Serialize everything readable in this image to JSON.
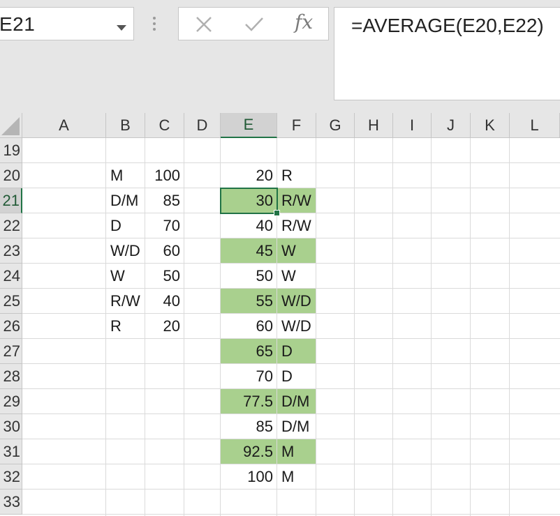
{
  "name_box": {
    "value": "E21"
  },
  "formula_bar": {
    "fx_label": "fx",
    "formula": "=AVERAGE(E20,E22)"
  },
  "colors": {
    "accent": "#217346",
    "fill_green": "#a9d08e"
  },
  "grid": {
    "columns": [
      "A",
      "B",
      "C",
      "D",
      "E",
      "F",
      "G",
      "H",
      "I",
      "J",
      "K",
      "L"
    ],
    "selected_column": "E",
    "rows": [
      "19",
      "20",
      "21",
      "22",
      "23",
      "24",
      "25",
      "26",
      "27",
      "28",
      "29",
      "30",
      "31",
      "32",
      "33"
    ],
    "selected_row": "21",
    "lookup_table": [
      {
        "row": "20",
        "B": "M",
        "C": "100"
      },
      {
        "row": "21",
        "B": "D/M",
        "C": "85"
      },
      {
        "row": "22",
        "B": "D",
        "C": "70"
      },
      {
        "row": "23",
        "B": "W/D",
        "C": "60"
      },
      {
        "row": "24",
        "B": "W",
        "C": "50"
      },
      {
        "row": "25",
        "B": "R/W",
        "C": "40"
      },
      {
        "row": "26",
        "B": "R",
        "C": "20"
      }
    ],
    "value_table": [
      {
        "row": "20",
        "E": "20",
        "F": "R",
        "shaded": false
      },
      {
        "row": "21",
        "E": "30",
        "F": "R/W",
        "shaded": true
      },
      {
        "row": "22",
        "E": "40",
        "F": "R/W",
        "shaded": false
      },
      {
        "row": "23",
        "E": "45",
        "F": "W",
        "shaded": true
      },
      {
        "row": "24",
        "E": "50",
        "F": "W",
        "shaded": false
      },
      {
        "row": "25",
        "E": "55",
        "F": "W/D",
        "shaded": true
      },
      {
        "row": "26",
        "E": "60",
        "F": "W/D",
        "shaded": false
      },
      {
        "row": "27",
        "E": "65",
        "F": "D",
        "shaded": true
      },
      {
        "row": "28",
        "E": "70",
        "F": "D",
        "shaded": false
      },
      {
        "row": "29",
        "E": "77.5",
        "F": "D/M",
        "shaded": true
      },
      {
        "row": "30",
        "E": "85",
        "F": "D/M",
        "shaded": false
      },
      {
        "row": "31",
        "E": "92.5",
        "F": "M",
        "shaded": true
      },
      {
        "row": "32",
        "E": "100",
        "F": "M",
        "shaded": false
      }
    ]
  }
}
